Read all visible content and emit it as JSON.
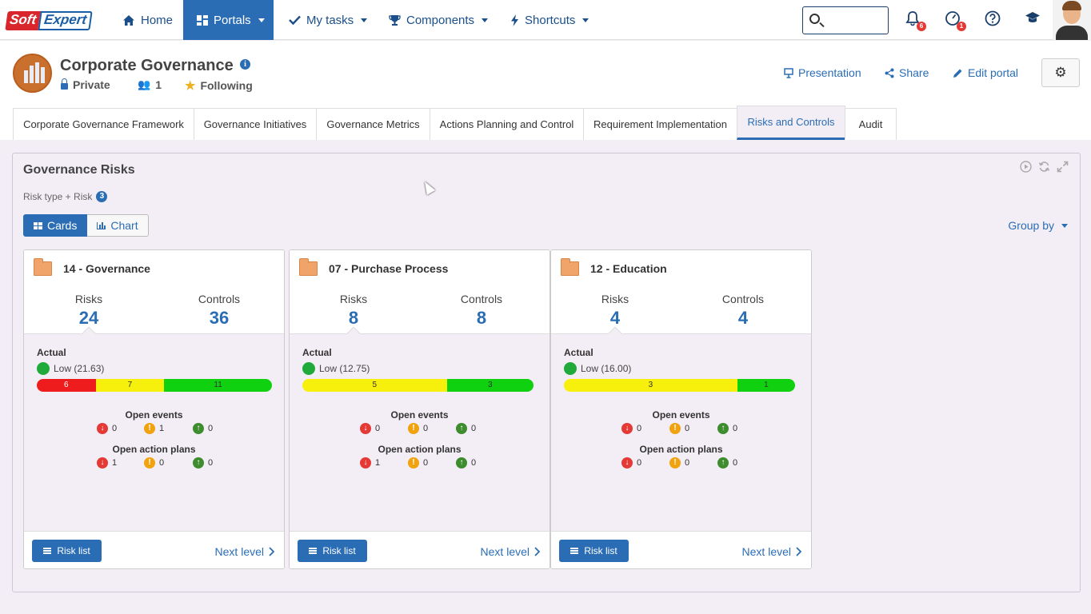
{
  "logo": {
    "part1": "Soft",
    "part2": "Expert"
  },
  "nav": {
    "home": "Home",
    "portals": "Portals",
    "my_tasks": "My tasks",
    "components": "Components",
    "shortcuts": "Shortcuts"
  },
  "search": {
    "value": ""
  },
  "notifications": {
    "bell_count": "6",
    "approvals_count": "1"
  },
  "portal": {
    "title": "Corporate Governance",
    "privacy": "Private",
    "members": "1",
    "following": "Following",
    "presentation": "Presentation",
    "share": "Share",
    "edit": "Edit portal"
  },
  "tabs": [
    {
      "label": "Corporate Governance Framework"
    },
    {
      "label": "Governance Initiatives"
    },
    {
      "label": "Governance Metrics"
    },
    {
      "label": "Actions Planning and Control"
    },
    {
      "label": "Requirement Implementation"
    },
    {
      "label": "Risks and Controls"
    },
    {
      "label": "Audit"
    }
  ],
  "panel": {
    "title": "Governance Risks",
    "crumb": "Risk type + Risk",
    "crumb_count": "3",
    "view_cards": "Cards",
    "view_chart": "Chart",
    "group_by": "Group by"
  },
  "cards": [
    {
      "title": "14 - Governance",
      "risks_label": "Risks",
      "risks": "24",
      "controls_label": "Controls",
      "controls": "36",
      "actual_label": "Actual",
      "level": "Low (21.63)",
      "bar": {
        "red": 6,
        "yellow": 7,
        "green": 11
      },
      "open_events_label": "Open events",
      "events": {
        "high": "0",
        "medium": "1",
        "low": "0"
      },
      "open_plans_label": "Open action plans",
      "plans": {
        "high": "1",
        "medium": "0",
        "low": "0"
      },
      "risk_list": "Risk list",
      "next_level": "Next level"
    },
    {
      "title": "07 - Purchase Process",
      "risks_label": "Risks",
      "risks": "8",
      "controls_label": "Controls",
      "controls": "8",
      "actual_label": "Actual",
      "level": "Low (12.75)",
      "bar": {
        "red": 0,
        "yellow": 5,
        "green": 3
      },
      "open_events_label": "Open events",
      "events": {
        "high": "0",
        "medium": "0",
        "low": "0"
      },
      "open_plans_label": "Open action plans",
      "plans": {
        "high": "1",
        "medium": "0",
        "low": "0"
      },
      "risk_list": "Risk list",
      "next_level": "Next level"
    },
    {
      "title": "12 - Education",
      "risks_label": "Risks",
      "risks": "4",
      "controls_label": "Controls",
      "controls": "4",
      "actual_label": "Actual",
      "level": "Low (16.00)",
      "bar": {
        "red": 0,
        "yellow": 3,
        "green": 1
      },
      "open_events_label": "Open events",
      "events": {
        "high": "0",
        "medium": "0",
        "low": "0"
      },
      "open_plans_label": "Open action plans",
      "plans": {
        "high": "0",
        "medium": "0",
        "low": "0"
      },
      "risk_list": "Risk list",
      "next_level": "Next level"
    }
  ]
}
